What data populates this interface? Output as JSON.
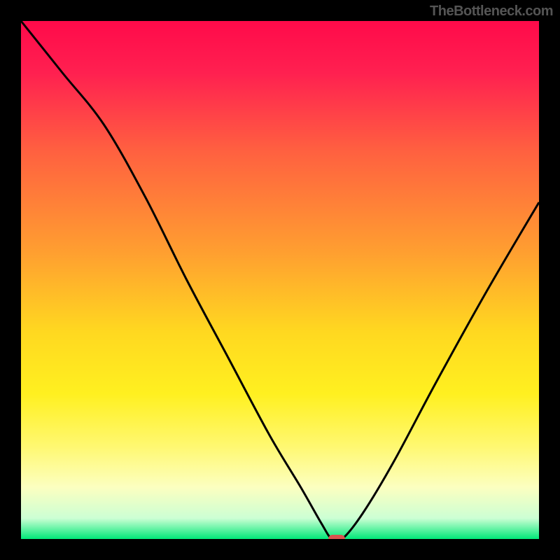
{
  "watermark": "TheBottleneck.com",
  "chart_data": {
    "type": "line",
    "title": "",
    "xlabel": "",
    "ylabel": "",
    "xlim": [
      0,
      100
    ],
    "ylim": [
      0,
      100
    ],
    "background": {
      "type": "vertical_gradient",
      "stops": [
        {
          "pos": 0.0,
          "color": "#ff0a4a"
        },
        {
          "pos": 0.1,
          "color": "#ff2050"
        },
        {
          "pos": 0.25,
          "color": "#ff6040"
        },
        {
          "pos": 0.45,
          "color": "#ffa030"
        },
        {
          "pos": 0.6,
          "color": "#ffd820"
        },
        {
          "pos": 0.72,
          "color": "#fff020"
        },
        {
          "pos": 0.82,
          "color": "#fff870"
        },
        {
          "pos": 0.9,
          "color": "#fcffc0"
        },
        {
          "pos": 0.96,
          "color": "#ccffd4"
        },
        {
          "pos": 1.0,
          "color": "#00e878"
        }
      ]
    },
    "series": [
      {
        "name": "bottleneck_curve",
        "color": "#000000",
        "x": [
          0,
          8,
          16,
          24,
          32,
          40,
          48,
          54,
          58,
          60,
          62,
          66,
          72,
          80,
          90,
          100
        ],
        "y": [
          100,
          90,
          80,
          66,
          50,
          35,
          20,
          10,
          3,
          0,
          0,
          5,
          15,
          30,
          48,
          65
        ]
      }
    ],
    "marker": {
      "x": 61,
      "y": 0,
      "color": "#d9544f"
    }
  }
}
